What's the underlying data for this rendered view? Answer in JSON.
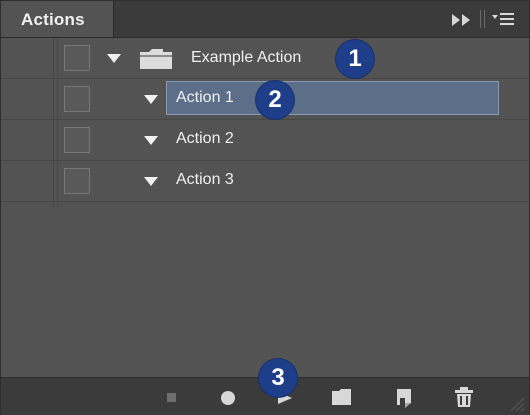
{
  "panel": {
    "tab_title": "Actions",
    "icons": {
      "collapse": "double-chevron-right-icon",
      "menu": "panel-menu-icon"
    }
  },
  "actions": {
    "set": {
      "name": "Example Action",
      "expanded": true,
      "icon": "folder-icon"
    },
    "items": [
      {
        "name": "Action 1",
        "selected": true,
        "expanded": false
      },
      {
        "name": "Action 2",
        "selected": false,
        "expanded": false
      },
      {
        "name": "Action 3",
        "selected": false,
        "expanded": false
      }
    ]
  },
  "annotations": {
    "badge1": "1",
    "badge2": "2",
    "badge3": "3"
  },
  "toolbar": {
    "buttons": [
      {
        "icon": "stop-icon",
        "enabled": false
      },
      {
        "icon": "record-icon",
        "enabled": true
      },
      {
        "icon": "play-icon",
        "enabled": true
      },
      {
        "icon": "new-set-folder-icon",
        "enabled": true
      },
      {
        "icon": "new-action-icon",
        "enabled": true
      },
      {
        "icon": "trash-icon",
        "enabled": true
      }
    ]
  },
  "colors": {
    "panel_bg": "#535353",
    "selection_bg": "#5d6e88",
    "badge": "#1e3e8a"
  }
}
